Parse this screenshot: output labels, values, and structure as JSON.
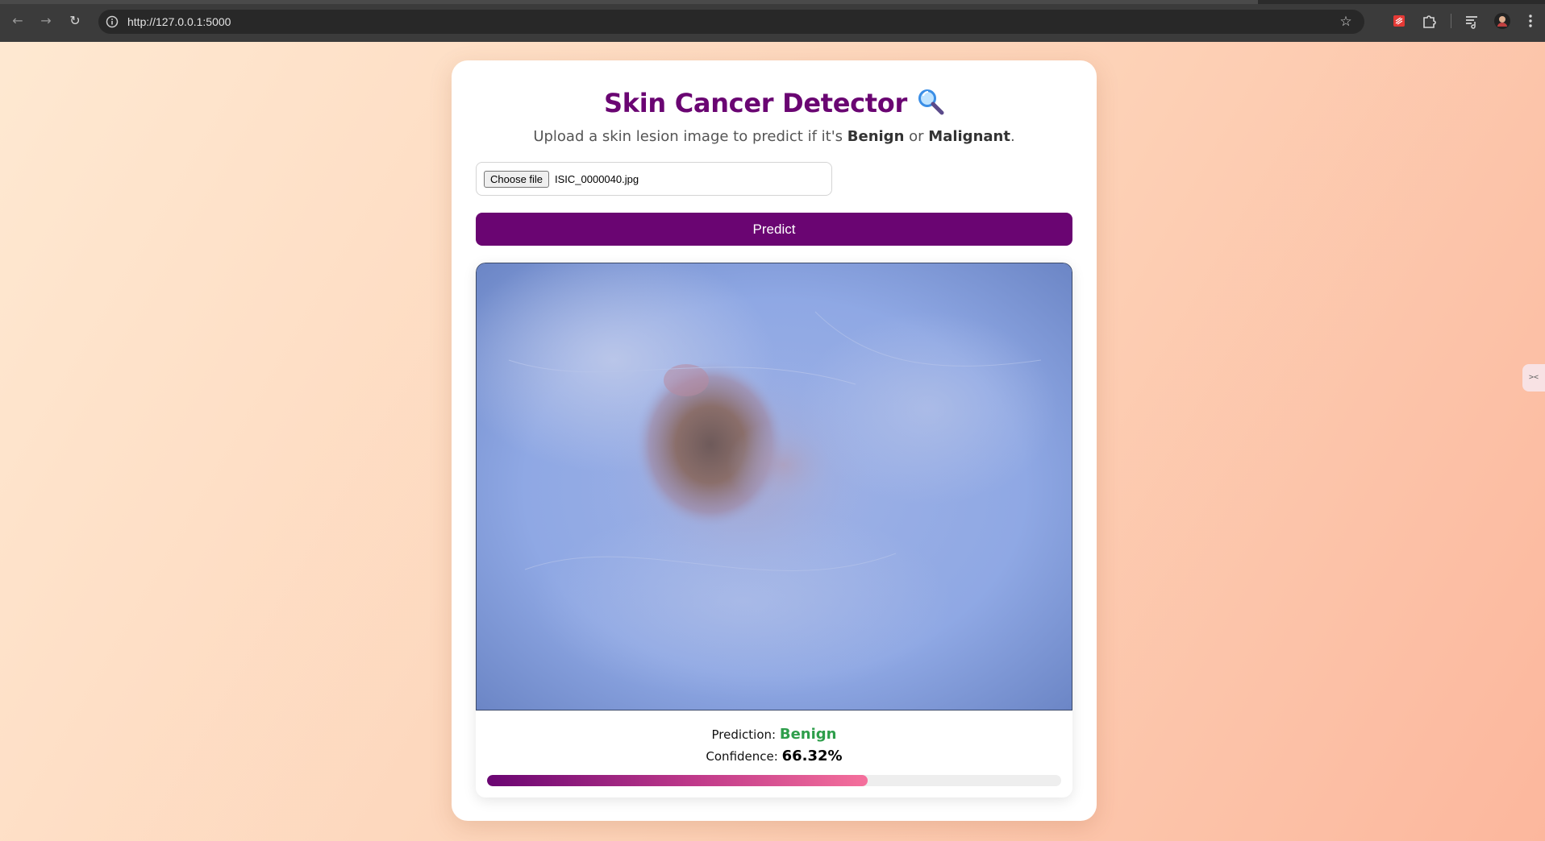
{
  "browser": {
    "url": "http://127.0.0.1:5000",
    "icons": [
      "back-arrow-icon",
      "forward-arrow-icon",
      "reload-icon",
      "site-info-icon",
      "bookmark-star-icon",
      "extension-red-icon",
      "extensions-puzzle-icon",
      "reading-list-icon",
      "profile-avatar-icon",
      "menu-kebab-icon"
    ]
  },
  "page": {
    "title": "Skin Cancer Detector",
    "title_icon": "magnifier-icon",
    "subtitle_prefix": "Upload a skin lesion image to predict if it's",
    "subtitle_benign": "Benign",
    "subtitle_or": "or",
    "subtitle_malignant": "Malignant",
    "subtitle_suffix": ".",
    "choose_file_label": "Choose file",
    "file_name": "ISIC_0000040.jpg",
    "predict_label": "Predict"
  },
  "result": {
    "prediction_label": "Prediction:",
    "prediction_value": "Benign",
    "confidence_label": "Confidence:",
    "confidence_value": "66.32%",
    "confidence_fraction": 0.6632
  },
  "colors": {
    "brand": "#6a0572",
    "benign": "#2e9e4b",
    "bar_end": "#f5709c"
  },
  "side_tab_text": "><"
}
